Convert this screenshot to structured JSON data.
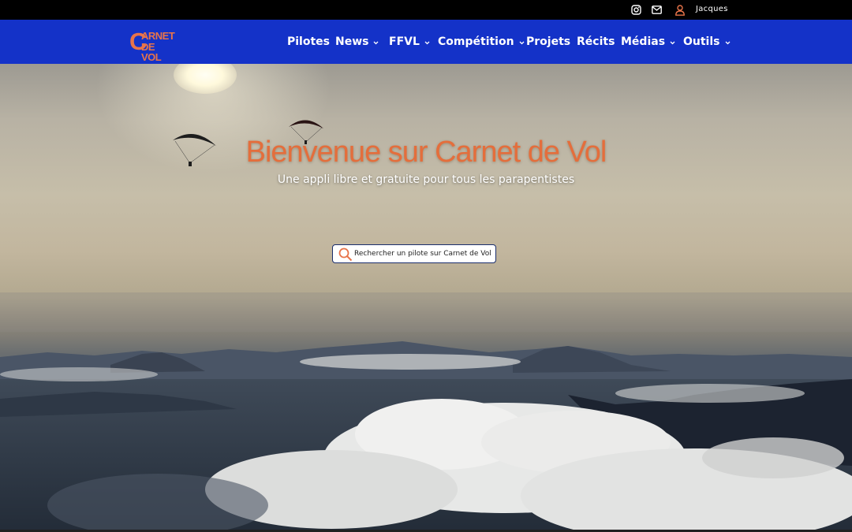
{
  "topbar": {
    "user_name": "Jacques",
    "icons": [
      "instagram-icon",
      "mail-icon",
      "user-icon"
    ],
    "user_icon_color": "#e8744a"
  },
  "navbar": {
    "background": "#1432c8",
    "logo": {
      "big_letter": "C",
      "line1": "ARNET",
      "line2": "DE VOL",
      "color": "#e8744a"
    },
    "items": [
      {
        "label": "Pilotes",
        "dropdown": false
      },
      {
        "label": "News",
        "dropdown": true
      },
      {
        "label": "FFVL",
        "dropdown": true
      },
      {
        "label": "Compétition",
        "dropdown": true
      },
      {
        "label": "Projets",
        "dropdown": false
      },
      {
        "label": "Récits",
        "dropdown": false
      },
      {
        "label": "Médias",
        "dropdown": true
      },
      {
        "label": "Outils",
        "dropdown": true
      }
    ]
  },
  "hero": {
    "title": "Bienvenue sur Carnet de Vol",
    "title_color": "#e46e3c",
    "subtitle": "Une appli libre et gratuite pour tous les parapentistes",
    "search": {
      "placeholder": "Rechercher un pilote sur Carnet de Vol",
      "icon_color": "#e8744a"
    }
  }
}
